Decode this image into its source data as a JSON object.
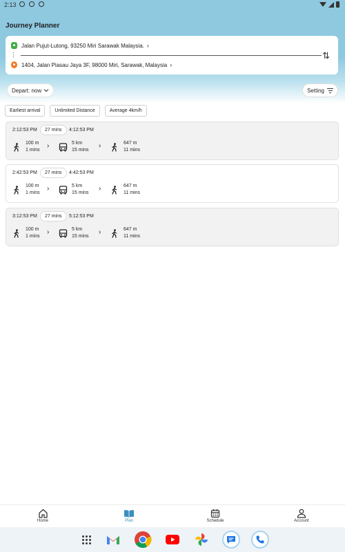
{
  "status_bar": {
    "time": "2:13"
  },
  "app": {
    "title": "Journey Planner"
  },
  "route": {
    "from": "Jalan Pujut-Lutong, 93250 Miri Sarawak Malaysia.",
    "to": "1404, Jalan Piasau Jaya 3F, 98000 Miri, Sarawak, Malaysia"
  },
  "controls": {
    "depart": "Depart: now",
    "setting": "Setting"
  },
  "filters": [
    "Earliest arrival",
    "Unlimited Distance",
    "Average 4km/h"
  ],
  "journeys": [
    {
      "depart": "2:12:53 PM",
      "duration": "27 mins",
      "arrive": "4:12:53 PM",
      "walk1_dist": "100 m",
      "walk1_time": "1 mins",
      "bus_dist": "5 km",
      "bus_time": "15 mins",
      "walk2_dist": "647 m",
      "walk2_time": "11 mins"
    },
    {
      "depart": "2:42:53 PM",
      "duration": "27 mins",
      "arrive": "4:42:53 PM",
      "walk1_dist": "100 m",
      "walk1_time": "1 mins",
      "bus_dist": "5 km",
      "bus_time": "15 mins",
      "walk2_dist": "647 m",
      "walk2_time": "11 mins"
    },
    {
      "depart": "3:12:53 PM",
      "duration": "27 mins",
      "arrive": "5:12:53 PM",
      "walk1_dist": "100 m",
      "walk1_time": "1 mins",
      "bus_dist": "5 km",
      "bus_time": "15 mins",
      "walk2_dist": "647 m",
      "walk2_time": "11 mins"
    }
  ],
  "bottom_nav": {
    "home": "Home",
    "plan": "Plan",
    "schedule": "Schedule",
    "account": "Account",
    "active": "plan"
  },
  "colors": {
    "accent": "#3a8fc0",
    "header_bg": "#8ec9e0",
    "origin_pin": "#3fae49",
    "destination_pin": "#f07a2a"
  },
  "dock": [
    "app-drawer-icon",
    "gmail-icon",
    "chrome-icon",
    "youtube-icon",
    "photos-icon",
    "messages-icon",
    "phone-icon"
  ]
}
